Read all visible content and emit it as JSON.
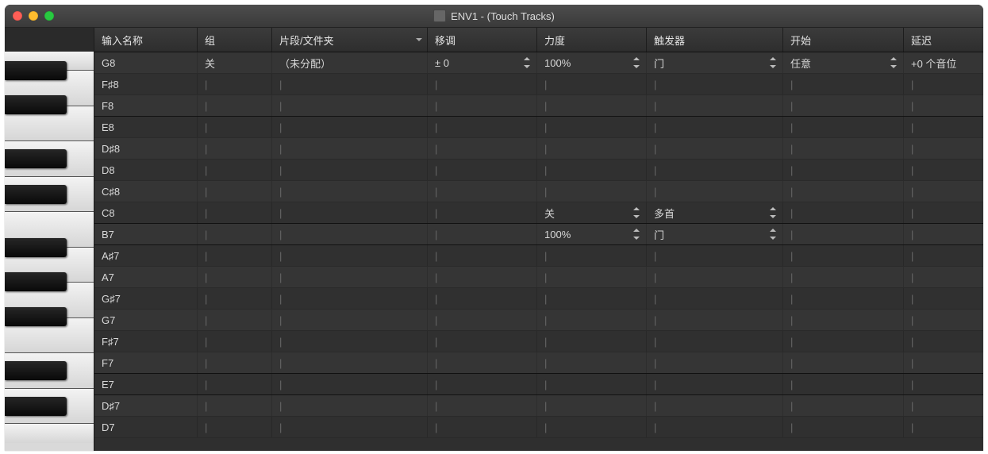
{
  "window": {
    "title": "ENV1 - (Touch Tracks)"
  },
  "columns": {
    "name": "输入名称",
    "group": "组",
    "region": "片段/文件夹",
    "trans": "移调",
    "vel": "力度",
    "trig": "触发器",
    "start": "开始",
    "delay": "延迟"
  },
  "notes": [
    "G8",
    "F♯8",
    "F8",
    "E8",
    "D♯8",
    "D8",
    "C♯8",
    "C8",
    "B7",
    "A♯7",
    "A7",
    "G♯7",
    "G7",
    "F♯7",
    "F7",
    "E7",
    "D♯7",
    "D7"
  ],
  "dividers": [
    "F8",
    "C8",
    "B7",
    "F7",
    "E7"
  ],
  "values_g8": {
    "group": "关",
    "region": "（未分配）",
    "trans": "± 0",
    "vel": "100%",
    "trig": "门",
    "start": "任意",
    "delay": "+0 个音位"
  },
  "values_c8": {
    "vel": "关",
    "trig": "多首"
  },
  "values_b7": {
    "vel": "100%",
    "trig": "门"
  },
  "tick": "|"
}
